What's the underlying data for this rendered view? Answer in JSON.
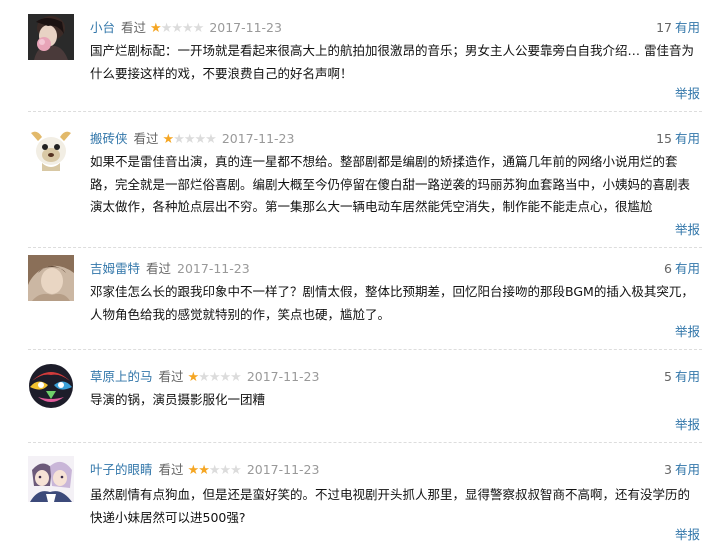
{
  "labels": {
    "seen": "看过",
    "useful": "有用",
    "report": "举报"
  },
  "colors": {
    "link": "#3377aa",
    "star_on": "#f5a623",
    "star_off": "#dcdcdc",
    "date": "#999999"
  },
  "reviews": [
    {
      "user": "小台",
      "rating": 1,
      "max_rating": 5,
      "date": "2017-11-23",
      "useful_count": "17",
      "avatar_icon": "girl-with-flower-avatar",
      "content": "国产烂剧标配：一开场就是看起来很高大上的航拍加很激昂的音乐；男女主人公要靠旁白自我介绍… 雷佳音为什么要接这样的戏，不要浪费自己的好名声啊！"
    },
    {
      "user": "搬砖侠",
      "rating": 1,
      "max_rating": 5,
      "date": "2017-11-23",
      "useful_count": "15",
      "avatar_icon": "cartoon-sheep-avatar",
      "content": "如果不是雷佳音出演，真的连一星都不想给。整部剧都是编剧的矫揉造作，通篇几年前的网络小说用烂的套路，完全就是一部烂俗喜剧。编剧大概至今仍停留在傻白甜一路逆袭的玛丽苏狗血套路当中，小姨妈的喜剧表演太做作，各种尬点层出不穷。第一集那么大一辆电动车居然能凭空消失，制作能不能走点心，很尴尬"
    },
    {
      "user": "吉姆雷特",
      "rating": 0,
      "max_rating": 5,
      "date": "2017-11-23",
      "useful_count": "6",
      "avatar_icon": "portrait-photo-avatar",
      "content": "邓家佳怎么长的跟我印象中不一样了？剧情太假，整体比预期差，回忆阳台接吻的那段BGM的插入极其突兀，人物角色给我的感觉就特别的作，笑点也硬，尴尬了。"
    },
    {
      "user": "草原上的马",
      "rating": 1,
      "max_rating": 5,
      "date": "2017-11-23",
      "useful_count": "5",
      "avatar_icon": "colorful-mask-avatar",
      "content": "导演的锅，演员摄影服化一团糟"
    },
    {
      "user": "叶子的眼睛",
      "rating": 2,
      "max_rating": 5,
      "date": "2017-11-23",
      "useful_count": "3",
      "avatar_icon": "anime-couple-avatar",
      "content": "虽然剧情有点狗血，但是还是蛮好笑的。不过电视剧开头抓人那里，显得警察叔叔智商不高啊，还有没学历的快递小妹居然可以进500强?"
    }
  ]
}
